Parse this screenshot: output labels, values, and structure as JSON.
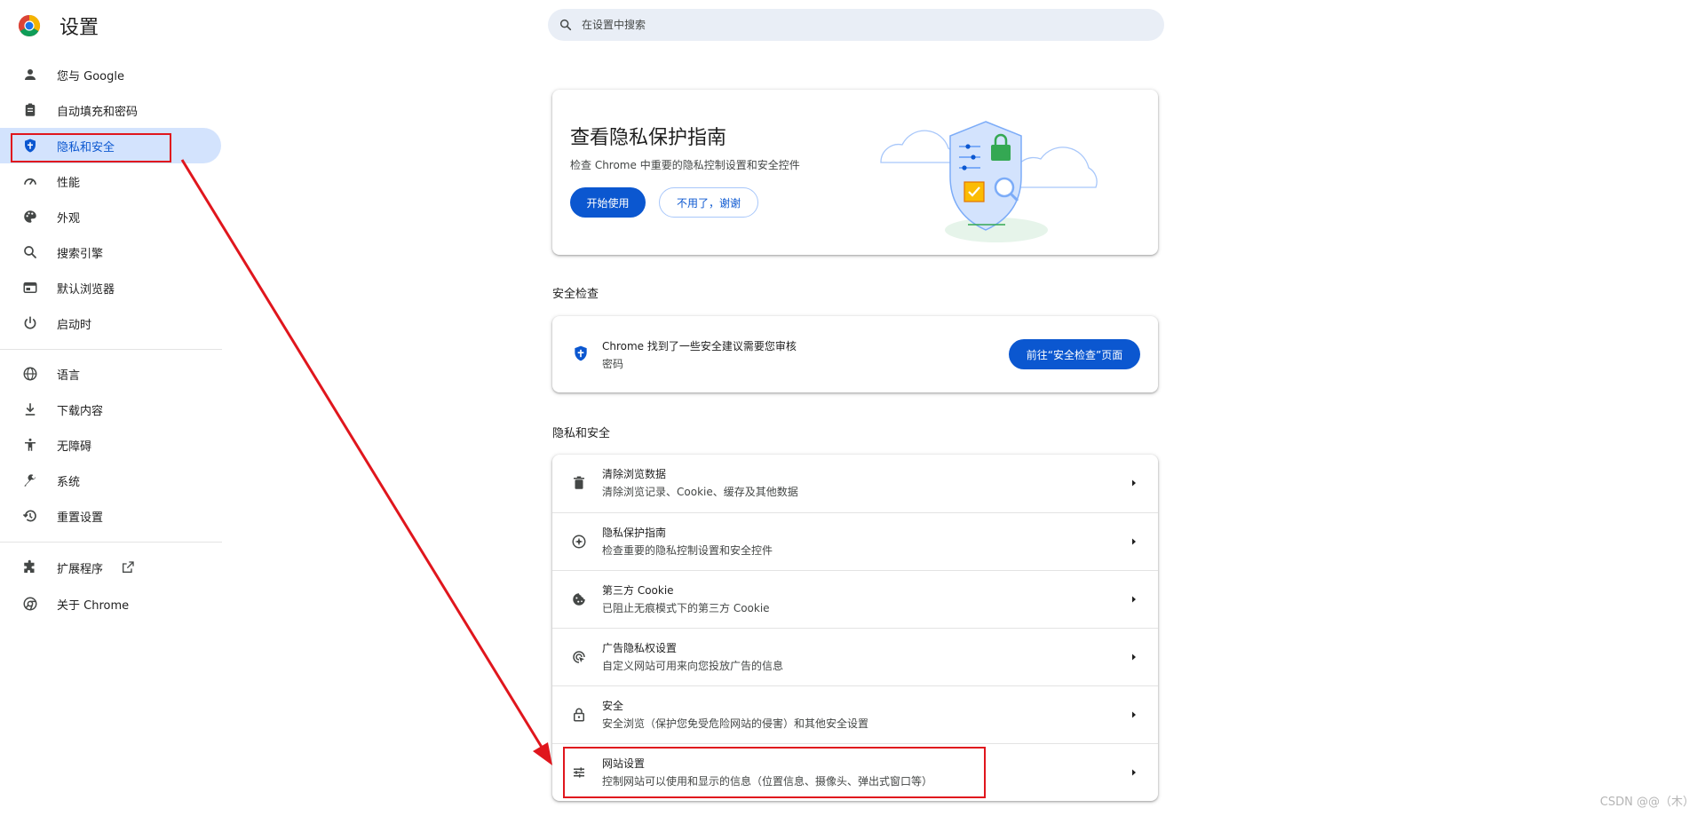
{
  "header": {
    "title": "设置",
    "logo_icon": "chrome-logo-icon",
    "search_placeholder": "在设置中搜索"
  },
  "sidebar": {
    "items": [
      {
        "label": "您与 Google",
        "icon": "person-icon",
        "active": false
      },
      {
        "label": "自动填充和密码",
        "icon": "clipboard-icon",
        "active": false
      },
      {
        "label": "隐私和安全",
        "icon": "shield-icon",
        "active": true
      },
      {
        "label": "性能",
        "icon": "speedometer-icon",
        "active": false
      },
      {
        "label": "外观",
        "icon": "palette-icon",
        "active": false
      },
      {
        "label": "搜索引擎",
        "icon": "search-icon",
        "active": false
      },
      {
        "label": "默认浏览器",
        "icon": "browser-window-icon",
        "active": false
      },
      {
        "label": "启动时",
        "icon": "power-icon",
        "active": false
      },
      {
        "label": "语言",
        "icon": "globe-icon",
        "active": false
      },
      {
        "label": "下载内容",
        "icon": "download-icon",
        "active": false
      },
      {
        "label": "无障碍",
        "icon": "accessibility-icon",
        "active": false
      },
      {
        "label": "系统",
        "icon": "wrench-icon",
        "active": false
      },
      {
        "label": "重置设置",
        "icon": "restore-icon",
        "active": false
      },
      {
        "label": "扩展程序",
        "icon": "puzzle-icon",
        "active": false
      },
      {
        "label": "关于 Chrome",
        "icon": "chrome-icon",
        "active": false
      }
    ]
  },
  "privacy_guide": {
    "title": "查看隐私保护指南",
    "description": "检查 Chrome 中重要的隐私控制设置和安全控件",
    "start_label": "开始使用",
    "no_thanks_label": "不用了，谢谢"
  },
  "safety_check": {
    "section_title": "安全检查",
    "line1": "Chrome 找到了一些安全建议需要您审核",
    "line2": "密码",
    "button_label": "前往“安全检查”页面"
  },
  "privacy_section": {
    "section_title": "隐私和安全",
    "rows": [
      {
        "title": "清除浏览数据",
        "subtitle": "清除浏览记录、Cookie、缓存及其他数据",
        "icon": "trash-icon"
      },
      {
        "title": "隐私保护指南",
        "subtitle": "检查重要的隐私控制设置和安全控件",
        "icon": "compass-icon"
      },
      {
        "title": "第三方 Cookie",
        "subtitle": "已阻止无痕模式下的第三方 Cookie",
        "icon": "cookie-icon"
      },
      {
        "title": "广告隐私权设置",
        "subtitle": "自定义网站可用来向您投放广告的信息",
        "icon": "ad-privacy-icon"
      },
      {
        "title": "安全",
        "subtitle": "安全浏览（保护您免受危险网站的侵害）和其他安全设置",
        "icon": "lock-icon"
      },
      {
        "title": "网站设置",
        "subtitle": "控制网站可以使用和显示的信息（位置信息、摄像头、弹出式窗口等）",
        "icon": "tune-icon"
      }
    ]
  },
  "watermark": "CSDN @@（木）",
  "colors": {
    "accent": "#0b57d0",
    "active_nav_bg": "#d3e3fd",
    "annotation_red": "#e0161d",
    "search_bg": "#e9eef6"
  }
}
